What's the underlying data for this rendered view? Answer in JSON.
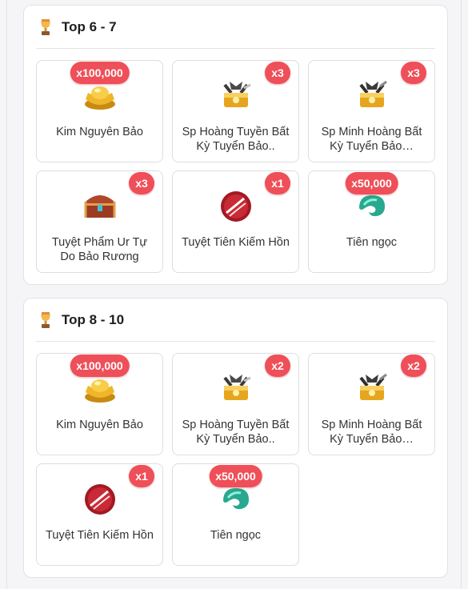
{
  "sections": [
    {
      "title": "Top 6 - 7",
      "items": [
        {
          "name": "Kim Nguyên Bảo",
          "qty": "x100,000",
          "icon": "gold-ingot-icon"
        },
        {
          "name": "Sp Hoàng Tuyền Bất Kỳ Tuyển Bảo..",
          "qty": "x3",
          "icon": "treasure-chest-icon"
        },
        {
          "name": "Sp Minh Hoàng Bất Kỳ Tuyển Bảo…",
          "qty": "x3",
          "icon": "treasure-chest-icon"
        },
        {
          "name": "Tuyệt Phẩm Ur Tự Do Bảo Rương",
          "qty": "x3",
          "icon": "treasure-box-icon"
        },
        {
          "name": "Tuyệt Tiên Kiếm Hồn",
          "qty": "x1",
          "icon": "sword-soul-orb-icon"
        },
        {
          "name": "Tiên ngọc",
          "qty": "x50,000",
          "icon": "jade-icon"
        }
      ]
    },
    {
      "title": "Top 8 - 10",
      "items": [
        {
          "name": "Kim Nguyên Bảo",
          "qty": "x100,000",
          "icon": "gold-ingot-icon"
        },
        {
          "name": "Sp Hoàng Tuyền Bất Kỳ Tuyển Bảo..",
          "qty": "x2",
          "icon": "treasure-chest-icon"
        },
        {
          "name": "Sp Minh Hoàng Bất Kỳ Tuyển Bảo…",
          "qty": "x2",
          "icon": "treasure-chest-icon"
        },
        {
          "name": "Tuyệt Tiên Kiếm Hồn",
          "qty": "x1",
          "icon": "sword-soul-orb-icon"
        },
        {
          "name": "Tiên ngọc",
          "qty": "x50,000",
          "icon": "jade-icon"
        }
      ]
    }
  ],
  "colors": {
    "badge": "#ef4f58",
    "card_border": "#dedee3"
  }
}
